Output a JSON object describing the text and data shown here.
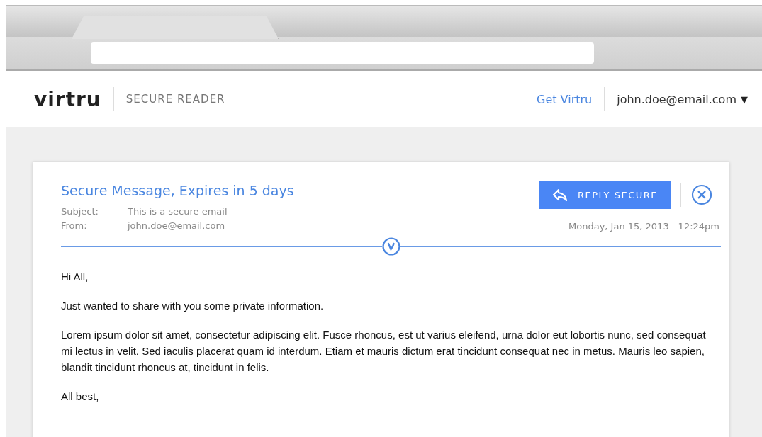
{
  "header": {
    "logo": "virtru",
    "section": "SECURE READER",
    "link": "Get Virtru",
    "account": "john.doe@email.com",
    "account_caret": "▼"
  },
  "message": {
    "title": "Secure Message, Expires in 5 days",
    "reply_button": "REPLY SECURE",
    "meta": [
      {
        "label": "Subject:",
        "value": "This is a secure email"
      },
      {
        "label": "From:",
        "value": "john.doe@email.com"
      }
    ],
    "date": "Monday, Jan 15, 2013 - 12:24pm",
    "body": [
      "Hi All,",
      "Just wanted to share with you some private information.",
      "Lorem ipsum dolor sit amet, consectetur adipiscing elit. Fusce rhoncus, est ut varius eleifend, urna dolor eut lobortis nunc, sed consequat mi lectus in velit. Sed iaculis placerat quam id interdum. Etiam et mauris dictum erat tincidunt consequat nec in metus. Mauris leo sapien, blandit tincidunt rhoncus at, tincidunt in felis.",
      "All best,"
    ]
  }
}
